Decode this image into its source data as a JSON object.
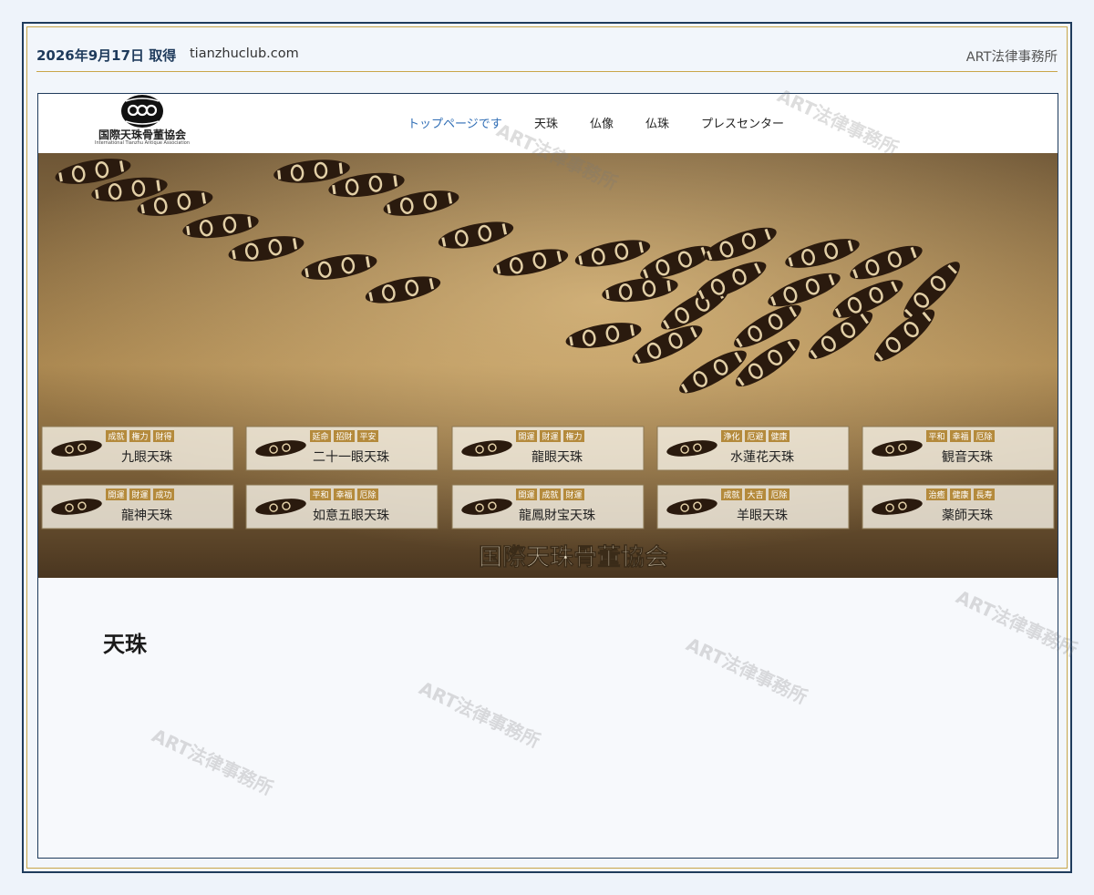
{
  "header": {
    "date": "2026年9月17日 取得",
    "domain": "tianzhuclub.com",
    "firm": "ART法律事務所"
  },
  "site": {
    "logo_title": "国際天珠骨董協会",
    "logo_subtitle": "International Tianzhu Antique Association",
    "nav": [
      "トップページです",
      "天珠",
      "仏像",
      "仏珠",
      "プレスセンター"
    ],
    "active_nav": "トップページです",
    "hero_cards": [
      {
        "tags": [
          "成就",
          "権力",
          "財得"
        ],
        "name": "九眼天珠"
      },
      {
        "tags": [
          "延命",
          "招財",
          "平安"
        ],
        "name": "二十一眼天珠"
      },
      {
        "tags": [
          "開運",
          "財運",
          "権力"
        ],
        "name": "龍眼天珠"
      },
      {
        "tags": [
          "浄化",
          "厄避",
          "健康"
        ],
        "name": "水蓮花天珠"
      },
      {
        "tags": [
          "平和",
          "幸福",
          "厄除"
        ],
        "name": "観音天珠"
      },
      {
        "tags": [
          "開運",
          "財運",
          "成功"
        ],
        "name": "龍神天珠"
      },
      {
        "tags": [
          "平和",
          "幸福",
          "厄除"
        ],
        "name": "如意五眼天珠"
      },
      {
        "tags": [
          "開運",
          "成就",
          "財運"
        ],
        "name": "龍鳳財宝天珠"
      },
      {
        "tags": [
          "成就",
          "大吉",
          "厄除"
        ],
        "name": "羊眼天珠"
      },
      {
        "tags": [
          "治癒",
          "健康",
          "長寿"
        ],
        "name": "薬師天珠"
      }
    ],
    "hero_banner": "国際天珠骨董協会",
    "page_heading": "天珠"
  },
  "watermark": "ART法律事務所",
  "colors": {
    "frame": "#1f3b5c",
    "gold": "#c9a649",
    "nav_active": "#2f6db5"
  }
}
